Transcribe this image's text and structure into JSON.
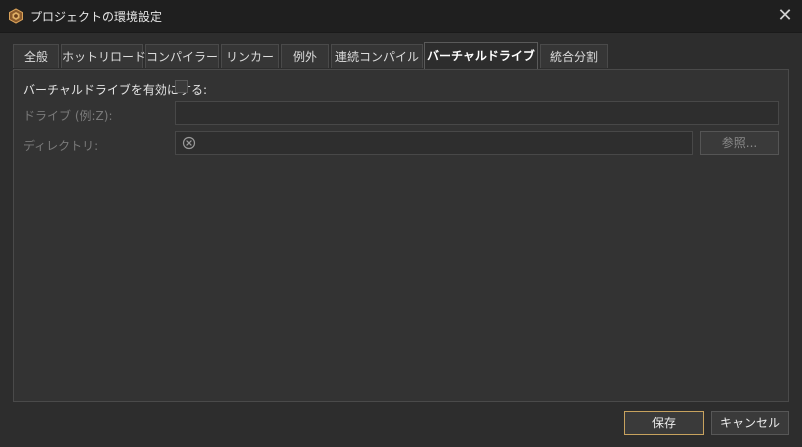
{
  "window": {
    "title": "プロジェクトの環境設定",
    "close_symbol": "✕",
    "icon": "app-logo-icon"
  },
  "tabs": [
    {
      "label": "全般",
      "active": false
    },
    {
      "label": "ホットリロード",
      "active": false
    },
    {
      "label": "コンパイラー",
      "active": false
    },
    {
      "label": "リンカー",
      "active": false
    },
    {
      "label": "例外",
      "active": false
    },
    {
      "label": "連続コンパイル",
      "active": false
    },
    {
      "label": "バーチャルドライブ",
      "active": true
    },
    {
      "label": "統合分割",
      "active": false
    }
  ],
  "form": {
    "enable_label": "バーチャルドライブを有効にする:",
    "enable_checked": false,
    "drive_label": "ドライブ (例:Z):",
    "drive_value": "",
    "directory_label": "ディレクトリ:",
    "directory_value": "",
    "browse_label": "参照..."
  },
  "footer": {
    "save_label": "保存",
    "cancel_label": "キャンセル"
  },
  "colors": {
    "background": "#2d2d2d",
    "accent_border": "#c7a25e"
  }
}
